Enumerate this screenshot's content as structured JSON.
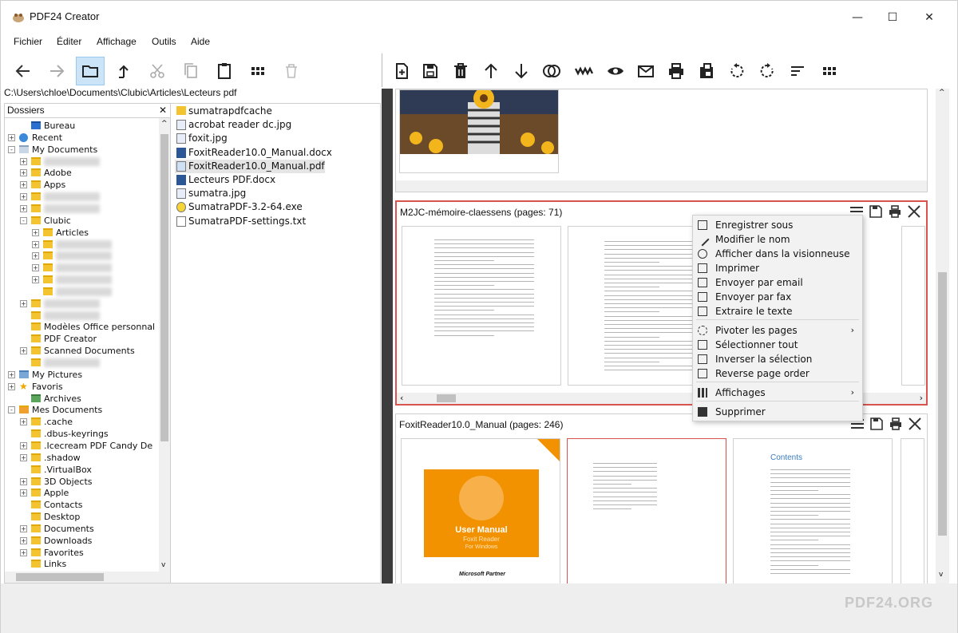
{
  "window": {
    "title": "PDF24 Creator",
    "minimize": "—",
    "maximize": "☐",
    "close": "✕"
  },
  "menu": [
    "Fichier",
    "Éditer",
    "Affichage",
    "Outils",
    "Aide"
  ],
  "path": "C:\\Users\\chloe\\Documents\\Clubic\\Articles\\Lecteurs pdf",
  "folders": {
    "header": "Dossiers",
    "items": [
      {
        "label": "Bureau",
        "icon": "desktop-icon"
      },
      {
        "label": "Recent",
        "icon": "recent-icon"
      },
      {
        "label": "My Documents",
        "icon": "documents-icon"
      },
      {
        "label": "Adobe",
        "icon": "folder-icon"
      },
      {
        "label": "Apps",
        "icon": "folder-icon"
      },
      {
        "label": "Clubic",
        "icon": "folder-icon"
      },
      {
        "label": "Articles",
        "icon": "folder-icon"
      },
      {
        "label": "Modèles Office personnal",
        "icon": "folder-icon"
      },
      {
        "label": "PDF Creator",
        "icon": "folder-icon"
      },
      {
        "label": "Scanned Documents",
        "icon": "folder-icon"
      },
      {
        "label": "My Pictures",
        "icon": "pictures-icon"
      },
      {
        "label": "Favoris",
        "icon": "star-icon"
      },
      {
        "label": "Archives",
        "icon": "archive-icon"
      },
      {
        "label": "Mes Documents",
        "icon": "user-folder-icon"
      },
      {
        "label": ".cache",
        "icon": "folder-icon"
      },
      {
        "label": ".dbus-keyrings",
        "icon": "folder-icon"
      },
      {
        "label": ".Icecream PDF Candy De",
        "icon": "folder-icon"
      },
      {
        "label": ".shadow",
        "icon": "folder-icon"
      },
      {
        "label": ".VirtualBox",
        "icon": "folder-icon"
      },
      {
        "label": "3D Objects",
        "icon": "folder-icon"
      },
      {
        "label": "Apple",
        "icon": "folder-icon"
      },
      {
        "label": "Contacts",
        "icon": "folder-icon"
      },
      {
        "label": "Desktop",
        "icon": "folder-icon"
      },
      {
        "label": "Documents",
        "icon": "folder-icon"
      },
      {
        "label": "Downloads",
        "icon": "folder-icon"
      },
      {
        "label": "Favorites",
        "icon": "folder-icon"
      },
      {
        "label": "Links",
        "icon": "folder-icon"
      }
    ]
  },
  "files": [
    {
      "name": "sumatrapdfcache",
      "icon": "folder-icon"
    },
    {
      "name": "acrobat reader dc.jpg",
      "icon": "image-file-icon"
    },
    {
      "name": "foxit.jpg",
      "icon": "image-file-icon"
    },
    {
      "name": "FoxitReader10.0_Manual.docx",
      "icon": "word-file-icon"
    },
    {
      "name": "FoxitReader10.0_Manual.pdf",
      "icon": "pdf-file-icon"
    },
    {
      "name": "Lecteurs PDF.docx",
      "icon": "word-file-icon"
    },
    {
      "name": "sumatra.jpg",
      "icon": "image-file-icon"
    },
    {
      "name": "SumatraPDF-3.2-64.exe",
      "icon": "exe-file-icon"
    },
    {
      "name": "SumatraPDF-settings.txt",
      "icon": "text-file-icon"
    }
  ],
  "documents": [
    {
      "title": "M2JC-mémoire-claessens (pages: 71)"
    },
    {
      "title": "FoxitReader10.0_Manual (pages: 246)"
    }
  ],
  "foxit_cover": {
    "title": "User Manual",
    "subtitle": "Foxit Reader",
    "platform": "For Windows",
    "partner": "Microsoft Partner"
  },
  "foxit_contents": "Contents",
  "context_menu": [
    {
      "label": "Enregistrer sous",
      "icon": "save-icon"
    },
    {
      "label": "Modifier le nom",
      "icon": "pencil-icon"
    },
    {
      "label": "Afficher dans la visionneuse",
      "icon": "eye-icon"
    },
    {
      "label": "Imprimer",
      "icon": "printer-icon"
    },
    {
      "label": "Envoyer par email",
      "icon": "mail-icon"
    },
    {
      "label": "Envoyer par fax",
      "icon": "fax-icon"
    },
    {
      "label": "Extraire le texte",
      "icon": "text-icon"
    },
    {
      "label": "Pivoter les pages",
      "icon": "rotate-icon",
      "submenu": true
    },
    {
      "label": "Sélectionner tout",
      "icon": "select-all-icon"
    },
    {
      "label": "Inverser la sélection",
      "icon": "invert-icon"
    },
    {
      "label": "Reverse page order",
      "icon": "reverse-icon"
    },
    {
      "label": "Affichages",
      "icon": "grid-icon",
      "submenu": true
    },
    {
      "label": "Supprimer",
      "icon": "trash-icon"
    }
  ],
  "brand": "PDF24.ORG",
  "colors": {
    "accent": "#f39200",
    "selection_border": "#d9534f",
    "active_tool": "#cce4f7",
    "splitter": "#3d3d3d"
  }
}
